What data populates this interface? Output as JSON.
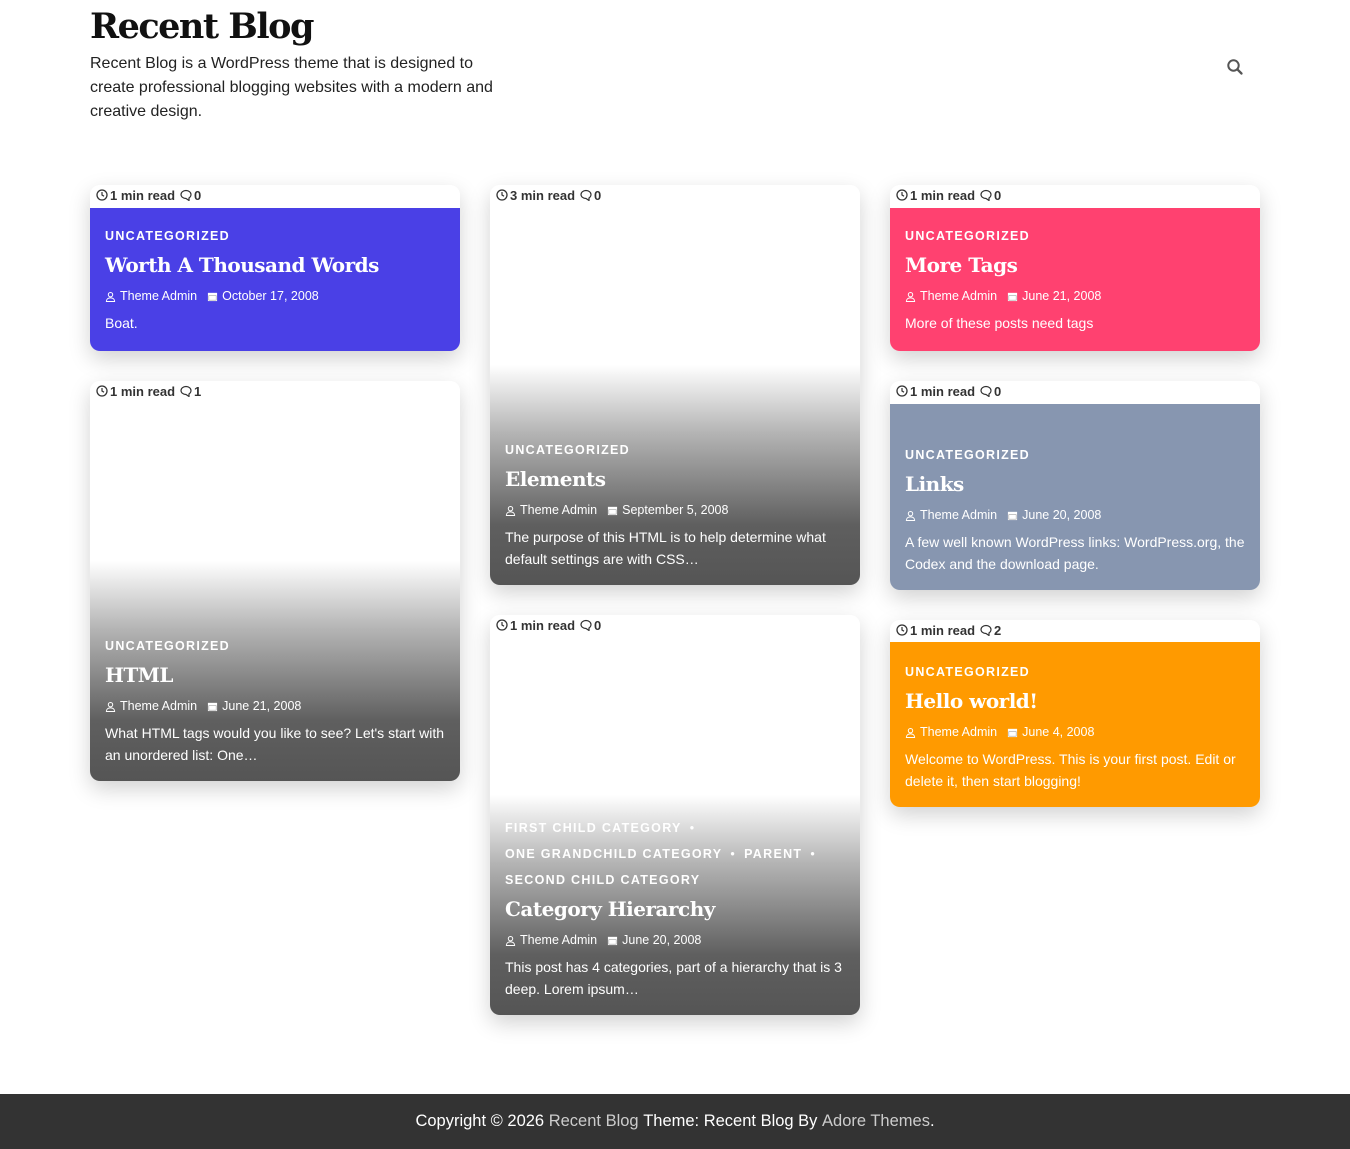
{
  "header": {
    "site_title": "Recent Blog",
    "site_description": "Recent Blog is a WordPress theme that is designed to create professional blogging websites with a modern and creative design.",
    "search_icon": "search-icon"
  },
  "posts": [
    {
      "read_time": "1 min read",
      "comments": "0",
      "categories": [
        "UNCATEGORIZED"
      ],
      "title": "Worth A Thousand Words",
      "author": "Theme Admin",
      "date": "October 17, 2008",
      "excerpt": "Boat.",
      "bg_color": "#4a40e6"
    },
    {
      "read_time": "3 min read",
      "comments": "0",
      "categories": [
        "UNCATEGORIZED"
      ],
      "title": "Elements",
      "author": "Theme Admin",
      "date": "September 5, 2008",
      "excerpt": "The purpose of this HTML is to help determine what default settings are with CSS…"
    },
    {
      "read_time": "1 min read",
      "comments": "0",
      "categories": [
        "UNCATEGORIZED"
      ],
      "title": "More Tags",
      "author": "Theme Admin",
      "date": "June 21, 2008",
      "excerpt": "More of these posts need tags",
      "bg_color": "#ff4170"
    },
    {
      "read_time": "1 min read",
      "comments": "1",
      "categories": [
        "UNCATEGORIZED"
      ],
      "title": "HTML",
      "author": "Theme Admin",
      "date": "June 21, 2008",
      "excerpt": "What HTML tags would you like to see? Let's start with an unordered list: One…"
    },
    {
      "read_time": "1 min read",
      "comments": "0",
      "categories": [
        "UNCATEGORIZED"
      ],
      "title": "Links",
      "author": "Theme Admin",
      "date": "June 20, 2008",
      "excerpt": "A few well known WordPress links: WordPress.org, the Codex and the download page.",
      "bg_color": "#8796b0"
    },
    {
      "read_time": "1 min read",
      "comments": "0",
      "categories": [
        "FIRST CHILD CATEGORY",
        "ONE GRANDCHILD CATEGORY",
        "PARENT",
        "SECOND CHILD CATEGORY"
      ],
      "title": "Category Hierarchy",
      "author": "Theme Admin",
      "date": "June 20, 2008",
      "excerpt": "This post has 4 categories, part of a hierarchy that is 3 deep. Lorem ipsum…"
    },
    {
      "read_time": "1 min read",
      "comments": "2",
      "categories": [
        "UNCATEGORIZED"
      ],
      "title": "Hello world!",
      "author": "Theme Admin",
      "date": "June 4, 2008",
      "excerpt": "Welcome to WordPress. This is your first post. Edit or delete it, then start blogging!",
      "bg_color": "#ff9a00"
    }
  ],
  "footer": {
    "copyright": "Copyright © 2026",
    "site_link": "Recent Blog",
    "theme_text": "Theme: Recent Blog By",
    "author_link": "Adore Themes",
    "period": "."
  }
}
